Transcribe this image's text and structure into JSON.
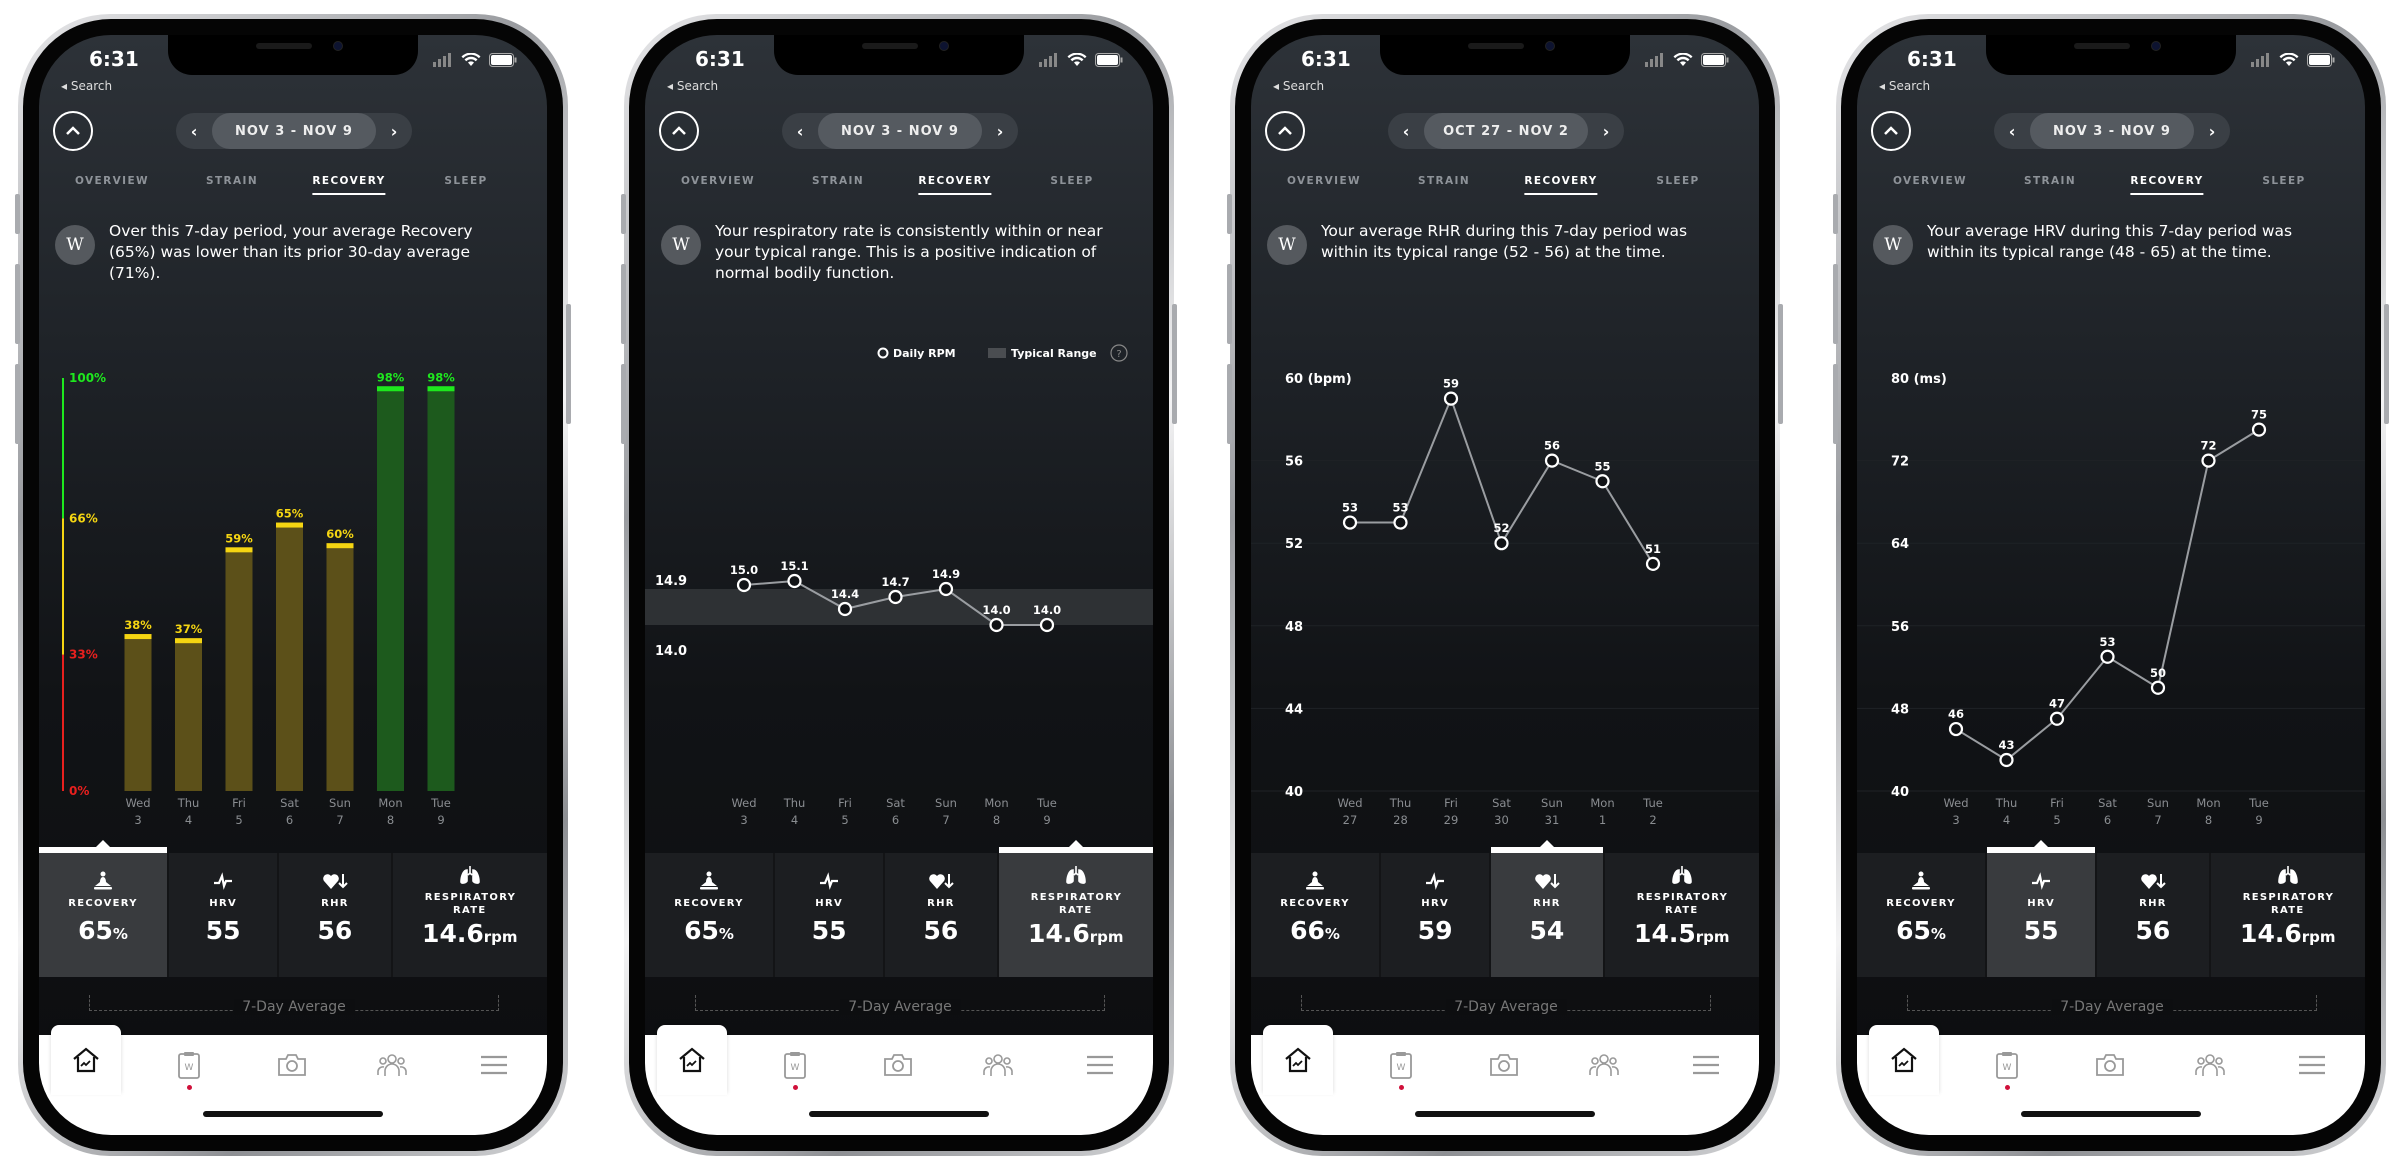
{
  "phones": [
    {
      "status_time": "6:31",
      "back_label": "Search",
      "date_range": "NOV 3 - NOV 9",
      "tabs": [
        "OVERVIEW",
        "STRAIN",
        "RECOVERY",
        "SLEEP"
      ],
      "active_tab": 2,
      "insight": "Over this 7-day period, your average Recovery (65%) was lower than its prior 30-day average (71%).",
      "stats": [
        {
          "label": "RECOVERY",
          "value": "65",
          "unit": "%",
          "icon": "meditation-icon"
        },
        {
          "label": "HRV",
          "value": "55",
          "unit": "",
          "icon": "hrv-pulse-icon"
        },
        {
          "label": "RHR",
          "value": "56",
          "unit": "",
          "icon": "heart-down-icon"
        },
        {
          "label": "RESPIRATORY RATE",
          "value": "14.6",
          "unit": "rpm",
          "icon": "lungs-icon"
        }
      ],
      "selected_stat": 0,
      "average_label": "7-Day Average"
    },
    {
      "status_time": "6:31",
      "back_label": "Search",
      "date_range": "NOV 3 - NOV 9",
      "tabs": [
        "OVERVIEW",
        "STRAIN",
        "RECOVERY",
        "SLEEP"
      ],
      "active_tab": 2,
      "insight": "Your respiratory rate is consistently within or near your typical range. This is a positive indication of normal bodily function.",
      "stats": [
        {
          "label": "RECOVERY",
          "value": "65",
          "unit": "%",
          "icon": "meditation-icon"
        },
        {
          "label": "HRV",
          "value": "55",
          "unit": "",
          "icon": "hrv-pulse-icon"
        },
        {
          "label": "RHR",
          "value": "56",
          "unit": "",
          "icon": "heart-down-icon"
        },
        {
          "label": "RESPIRATORY RATE",
          "value": "14.6",
          "unit": "rpm",
          "icon": "lungs-icon"
        }
      ],
      "selected_stat": 3,
      "average_label": "7-Day Average"
    },
    {
      "status_time": "6:31",
      "back_label": "Search",
      "date_range": "OCT 27 - NOV 2",
      "tabs": [
        "OVERVIEW",
        "STRAIN",
        "RECOVERY",
        "SLEEP"
      ],
      "active_tab": 2,
      "insight": "Your average RHR during this 7-day period was within its typical range (52 - 56) at the time.",
      "stats": [
        {
          "label": "RECOVERY",
          "value": "66",
          "unit": "%",
          "icon": "meditation-icon"
        },
        {
          "label": "HRV",
          "value": "59",
          "unit": "",
          "icon": "hrv-pulse-icon"
        },
        {
          "label": "RHR",
          "value": "54",
          "unit": "",
          "icon": "heart-down-icon"
        },
        {
          "label": "RESPIRATORY RATE",
          "value": "14.5",
          "unit": "rpm",
          "icon": "lungs-icon"
        }
      ],
      "selected_stat": 2,
      "average_label": "7-Day Average"
    },
    {
      "status_time": "6:31",
      "back_label": "Search",
      "date_range": "NOV 3 - NOV 9",
      "tabs": [
        "OVERVIEW",
        "STRAIN",
        "RECOVERY",
        "SLEEP"
      ],
      "active_tab": 2,
      "insight": "Your average HRV during this 7-day period was within its typical range (48 - 65) at the time.",
      "stats": [
        {
          "label": "RECOVERY",
          "value": "65",
          "unit": "%",
          "icon": "meditation-icon"
        },
        {
          "label": "HRV",
          "value": "55",
          "unit": "",
          "icon": "hrv-pulse-icon"
        },
        {
          "label": "RHR",
          "value": "56",
          "unit": "",
          "icon": "heart-down-icon"
        },
        {
          "label": "RESPIRATORY RATE",
          "value": "14.6",
          "unit": "rpm",
          "icon": "lungs-icon"
        }
      ],
      "selected_stat": 1,
      "average_label": "7-Day Average"
    }
  ],
  "nav_icons": [
    "home-chart-icon",
    "journal-clipboard-icon",
    "camera-icon",
    "community-icon",
    "menu-icon"
  ],
  "colors": {
    "green": "#1ee81e",
    "yellow": "#f5d512",
    "red": "#e8201e",
    "green_fill": "#1d5a1d",
    "yellow_fill": "#5c5019",
    "notification": "#d0103a"
  },
  "chart_data": [
    {
      "type": "bar",
      "categories": [
        "Wed 3",
        "Thu 4",
        "Fri 5",
        "Sat 6",
        "Sun 7",
        "Mon 8",
        "Tue 9"
      ],
      "days": [
        "Wed",
        "Thu",
        "Fri",
        "Sat",
        "Sun",
        "Mon",
        "Tue"
      ],
      "dates": [
        "3",
        "4",
        "5",
        "6",
        "7",
        "8",
        "9"
      ],
      "values": [
        38,
        37,
        59,
        65,
        60,
        98,
        98
      ],
      "value_labels": [
        "38%",
        "37%",
        "59%",
        "65%",
        "60%",
        "98%",
        "98%"
      ],
      "ylim": [
        0,
        100
      ],
      "yticks": [
        {
          "value": 100,
          "label": "100%",
          "color": "#1ee81e"
        },
        {
          "value": 66,
          "label": "66%",
          "color": "#f5d512"
        },
        {
          "value": 33,
          "label": "33%",
          "color": "#e8201e"
        },
        {
          "value": 0,
          "label": "0%",
          "color": "#e8201e"
        }
      ],
      "grid": false
    },
    {
      "type": "line",
      "categories": [
        "Wed 3",
        "Thu 4",
        "Fri 5",
        "Sat 6",
        "Sun 7",
        "Mon 8",
        "Tue 9"
      ],
      "days": [
        "Wed",
        "Thu",
        "Fri",
        "Sat",
        "Sun",
        "Mon",
        "Tue"
      ],
      "dates": [
        "3",
        "4",
        "5",
        "6",
        "7",
        "8",
        "9"
      ],
      "values": [
        15.0,
        15.1,
        14.4,
        14.7,
        14.9,
        14.0,
        14.0
      ],
      "value_labels": [
        "15.0",
        "15.1",
        "14.4",
        "14.7",
        "14.9",
        "14.0",
        "14.0"
      ],
      "typical_range": [
        14.0,
        14.9
      ],
      "yticks": [
        {
          "value": 14.9,
          "label": "14.9"
        },
        {
          "value": 14.0,
          "label": "14.0"
        }
      ],
      "legend": {
        "series": "Daily RPM",
        "range": "Typical Range",
        "help": "?",
        "position": "top-right"
      },
      "grid": false
    },
    {
      "type": "line",
      "categories": [
        "Wed 27",
        "Thu 28",
        "Fri 29",
        "Sat 30",
        "Sun 31",
        "Mon 1",
        "Tue 2"
      ],
      "days": [
        "Wed",
        "Thu",
        "Fri",
        "Sat",
        "Sun",
        "Mon",
        "Tue"
      ],
      "dates": [
        "27",
        "28",
        "29",
        "30",
        "31",
        "1",
        "2"
      ],
      "values": [
        53,
        53,
        59,
        52,
        56,
        55,
        51
      ],
      "value_labels": [
        "53",
        "53",
        "59",
        "52",
        "56",
        "55",
        "51"
      ],
      "ylim": [
        40,
        60
      ],
      "yticks": [
        {
          "value": 60,
          "label": "60 (bpm)"
        },
        {
          "value": 56,
          "label": "56"
        },
        {
          "value": 52,
          "label": "52"
        },
        {
          "value": 48,
          "label": "48"
        },
        {
          "value": 44,
          "label": "44"
        },
        {
          "value": 40,
          "label": "40"
        }
      ],
      "grid": true
    },
    {
      "type": "line",
      "categories": [
        "Wed 3",
        "Thu 4",
        "Fri 5",
        "Sat 6",
        "Sun 7",
        "Mon 8",
        "Tue 9"
      ],
      "days": [
        "Wed",
        "Thu",
        "Fri",
        "Sat",
        "Sun",
        "Mon",
        "Tue"
      ],
      "dates": [
        "3",
        "4",
        "5",
        "6",
        "7",
        "8",
        "9"
      ],
      "values": [
        46,
        43,
        47,
        53,
        50,
        72,
        75
      ],
      "value_labels": [
        "46",
        "43",
        "47",
        "53",
        "50",
        "72",
        "75"
      ],
      "ylim": [
        40,
        80
      ],
      "yticks": [
        {
          "value": 80,
          "label": "80 (ms)"
        },
        {
          "value": 72,
          "label": "72"
        },
        {
          "value": 64,
          "label": "64"
        },
        {
          "value": 56,
          "label": "56"
        },
        {
          "value": 48,
          "label": "48"
        },
        {
          "value": 40,
          "label": "40"
        }
      ],
      "grid": true
    }
  ]
}
